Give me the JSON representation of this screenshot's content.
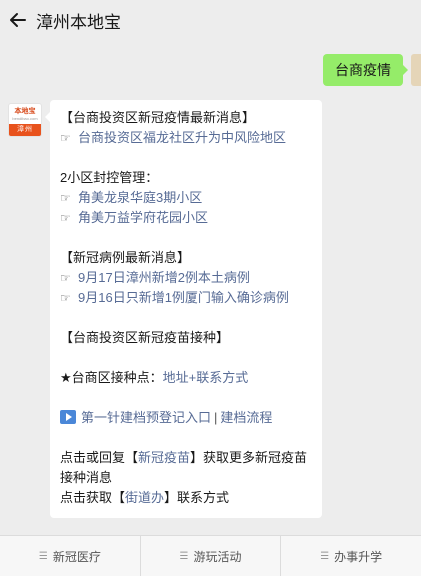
{
  "header": {
    "title": "漳州本地宝"
  },
  "outgoing": {
    "text": "台商疫情"
  },
  "avatar": {
    "logo": "本地宝",
    "logo_sub": "bendibao.com",
    "city": "漳州"
  },
  "message": {
    "h1": "【台商投资区新冠疫情最新消息】",
    "l1": "台商投资区福龙社区升为中风险地区",
    "h2": "2小区封控管理：",
    "l2": "角美龙泉华庭3期小区",
    "l3": "角美万益学府花园小区",
    "h3": "【新冠病例最新消息】",
    "l4": "9月17日漳州新增2例本土病例",
    "l5": "9月16日只新增1例厦门输入确诊病例",
    "h4": "【台商投资区新冠疫苗接种】",
    "point_prefix": "★台商区接种点：",
    "point_link": "地址+联系方式",
    "reg_link": "第一针建档预登记入口",
    "reg_sep": "|",
    "flow_link": "建档流程",
    "reply_pre": "点击或回复【",
    "reply_link": "新冠疫苗",
    "reply_post": "】获取更多新冠疫苗接种消息",
    "get_pre": "点击获取【",
    "get_link": "街道办",
    "get_post": "】联系方式"
  },
  "menu": [
    {
      "label": "新冠医疗",
      "icon": "menu-icon"
    },
    {
      "label": "游玩活动",
      "icon": "menu-icon"
    },
    {
      "label": "办事升学",
      "icon": "menu-icon"
    }
  ]
}
